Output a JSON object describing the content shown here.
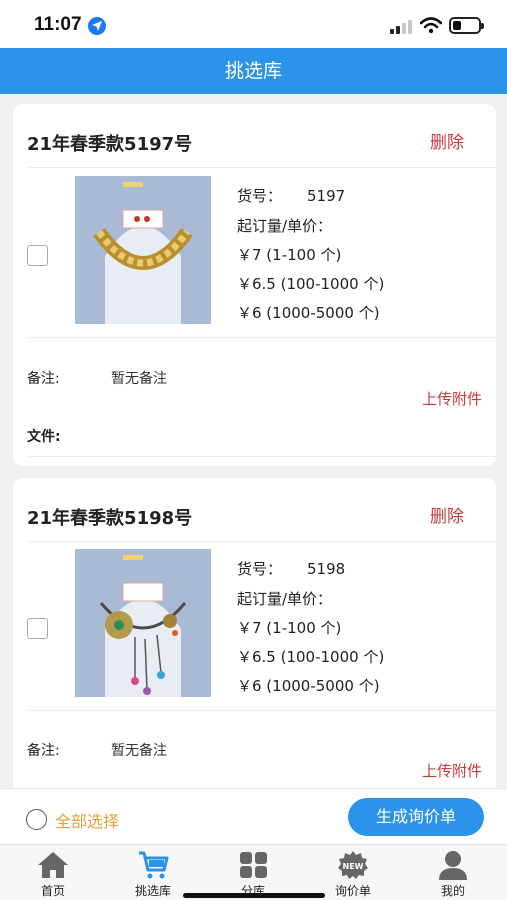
{
  "status_bar": {
    "time": "11:07",
    "location_icon": "location-arrow-icon",
    "signal_icon": "cellular-signal-icon",
    "wifi_icon": "wifi-icon",
    "battery_icon": "battery-icon"
  },
  "header": {
    "title": "挑选库"
  },
  "products": [
    {
      "title": "21年春季款5197号",
      "delete_label": "删除",
      "sku_label": "货号：",
      "sku_value": "5197",
      "moq_label": "起订量/单价：",
      "prices": [
        "￥7 (1-100 个)",
        "￥6.5 (100-1000 个)",
        "￥6 (1000-5000 个)"
      ],
      "remark_label": "备注:",
      "remark_value": "暂无备注",
      "upload_label": "上传附件",
      "file_label": "文件:",
      "image": "gold-chain-necklace-photo",
      "checked": false
    },
    {
      "title": "21年春季款5198号",
      "delete_label": "删除",
      "sku_label": "货号：",
      "sku_value": "5198",
      "moq_label": "起订量/单价：",
      "prices": [
        "￥7 (1-100 个)",
        "￥6.5 (100-1000 个)",
        "￥6 (1000-5000 个)"
      ],
      "remark_label": "备注:",
      "remark_value": "暂无备注",
      "upload_label": "上传附件",
      "image": "flower-pendant-necklace-photo",
      "checked": false
    }
  ],
  "footer": {
    "select_all_label": "全部选择",
    "generate_quote_label": "生成询价单",
    "select_all_checked": false
  },
  "tab_bar": {
    "active_color": "#2b93ea",
    "items": [
      {
        "label": "首页",
        "icon": "home-icon"
      },
      {
        "label": "挑选库",
        "icon": "cart-icon",
        "active": true
      },
      {
        "label": "分库",
        "icon": "grid-icon"
      },
      {
        "label": "询价单",
        "icon": "new-badge-icon"
      },
      {
        "label": "我的",
        "icon": "user-icon"
      }
    ]
  },
  "colors": {
    "primary": "#2b93ea",
    "danger": "#c93a3a",
    "accent": "#e6a238"
  }
}
